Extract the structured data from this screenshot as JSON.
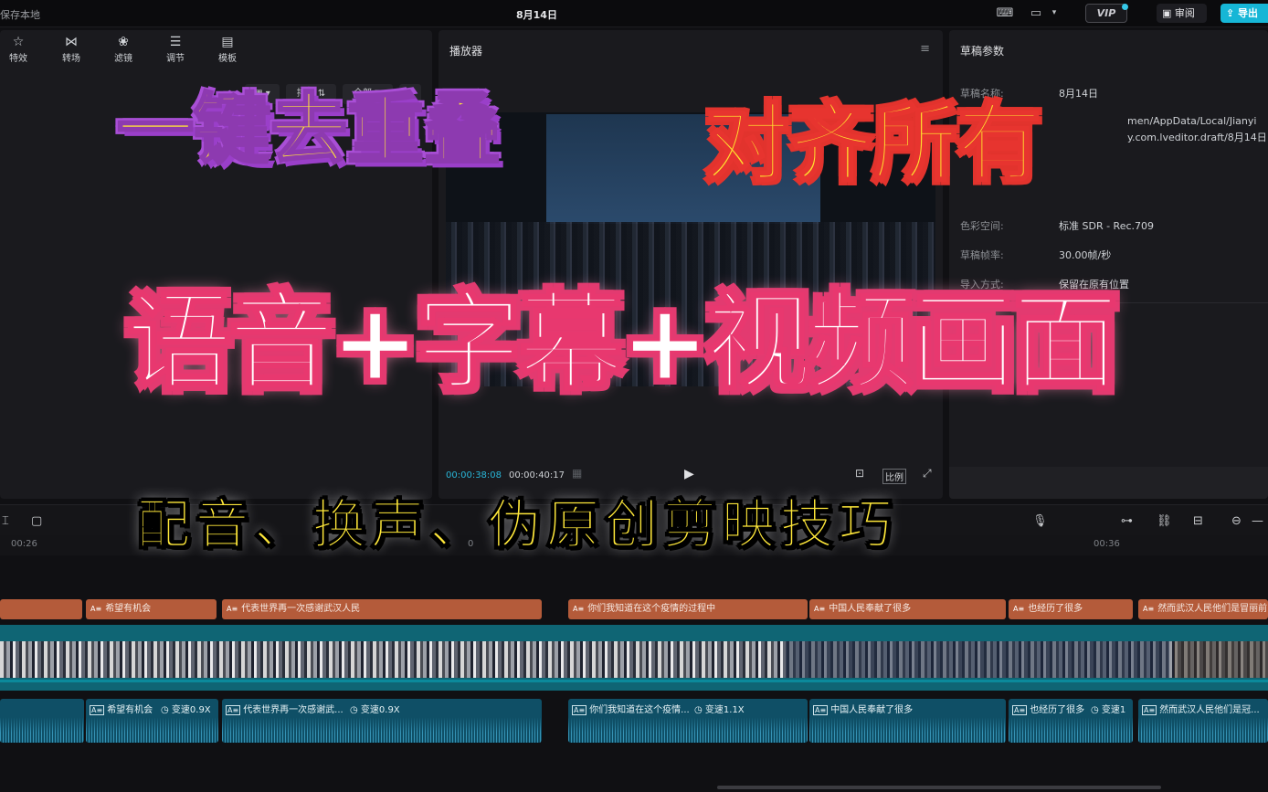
{
  "topbar": {
    "save_status": "保存本地",
    "project_title": "8月14日",
    "vip_label": "VIP",
    "review_label": "审阅",
    "export_label": "导出"
  },
  "toolbar": {
    "items": [
      {
        "label": "特效",
        "icon": "star-sparkle-icon"
      },
      {
        "label": "转场",
        "icon": "bowtie-transition-icon"
      },
      {
        "label": "滤镜",
        "icon": "circles-filter-icon"
      },
      {
        "label": "调节",
        "icon": "sliders-adjust-icon"
      },
      {
        "label": "模板",
        "icon": "template-icon"
      }
    ],
    "sort_label": "排序",
    "filter_label": "全部"
  },
  "player": {
    "title": "播放器",
    "current_time": "00:00:38:08",
    "duration": "00:00:40:17",
    "ratio_label": "比例"
  },
  "draft": {
    "title": "草稿参数",
    "fields": [
      {
        "key": "草稿名称:",
        "value": "8月14日"
      },
      {
        "key": "",
        "value": "men/AppData/Local/Jianyi"
      },
      {
        "key": "",
        "value": "y.com.lveditor.draft/8月14日"
      },
      {
        "key": "色彩空间:",
        "value": "标准 SDR - Rec.709"
      },
      {
        "key": "草稿帧率:",
        "value": "30.00帧/秒"
      },
      {
        "key": "导入方式:",
        "value": "保留在原有位置"
      }
    ]
  },
  "timeline": {
    "ruler": [
      "00:26",
      "0",
      "00:36"
    ],
    "subtitles": [
      {
        "text": ""
      },
      {
        "text": "希望有机会"
      },
      {
        "text": "代表世界再一次感谢武汉人民"
      },
      {
        "text": "你们我知道在这个疫情的过程中"
      },
      {
        "text": "中国人民奉献了很多"
      },
      {
        "text": "也经历了很多"
      },
      {
        "text": "然而武汉人民他们是冒丽前"
      }
    ],
    "audio": [
      {
        "text": "",
        "speed": ""
      },
      {
        "text": "希望有机会",
        "speed": "变速0.9X"
      },
      {
        "text": "代表世界再一次感谢武...",
        "speed": "变速0.9X"
      },
      {
        "text": "你们我知道在这个疫情...",
        "speed": "变速1.1X"
      },
      {
        "text": "中国人民奉献了很多",
        "speed": ""
      },
      {
        "text": "也经历了很多",
        "speed": "变速1"
      },
      {
        "text": "然而武汉人民他们是冠...",
        "speed": ""
      }
    ]
  },
  "overlay": {
    "line1": "一键去重叠",
    "line2": "对齐所有",
    "line3": "语音+字幕+视频画面",
    "line4": "配音、换声、伪原创剪映技巧"
  },
  "colors": {
    "accent": "#16b6d6",
    "subtitle_clip": "#b45b3a",
    "video_track": "#0f6574",
    "audio_clip": "#0f4f66"
  }
}
